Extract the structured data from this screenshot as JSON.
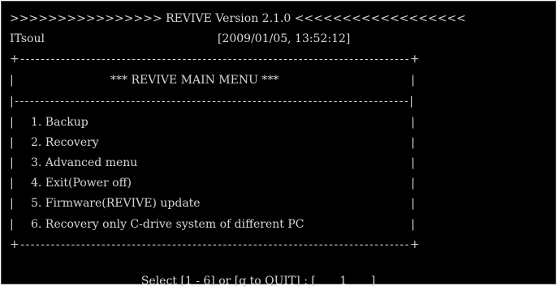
{
  "header": {
    "banner": ">>>>>>>>>>>>>>>> REVIVE Version 2.1.0 <<<<<<<<<<<<<<<<<<",
    "vendor": "ITsoul",
    "datetime": "[2009/01/05, 13:52:12]"
  },
  "menu": {
    "top_border": "+-----------------------------------------------------------------------------+",
    "title": "*** REVIVE MAIN MENU ***",
    "separator": "|------------------------------------------------------------------------------|",
    "bottom_border": "+-----------------------------------------------------------------------------+",
    "items": [
      {
        "label": "1. Backup"
      },
      {
        "label": "2. Recovery"
      },
      {
        "label": "3. Advanced menu"
      },
      {
        "label": "4. Exit(Power off)"
      },
      {
        "label": "5. Firmware(REVIVE) update"
      },
      {
        "label": "6. Recovery only C-drive system of different PC"
      }
    ]
  },
  "prompt": {
    "text": "Select [1 - 6] or [q to QUIT] : [",
    "value": "1",
    "close": "]"
  }
}
